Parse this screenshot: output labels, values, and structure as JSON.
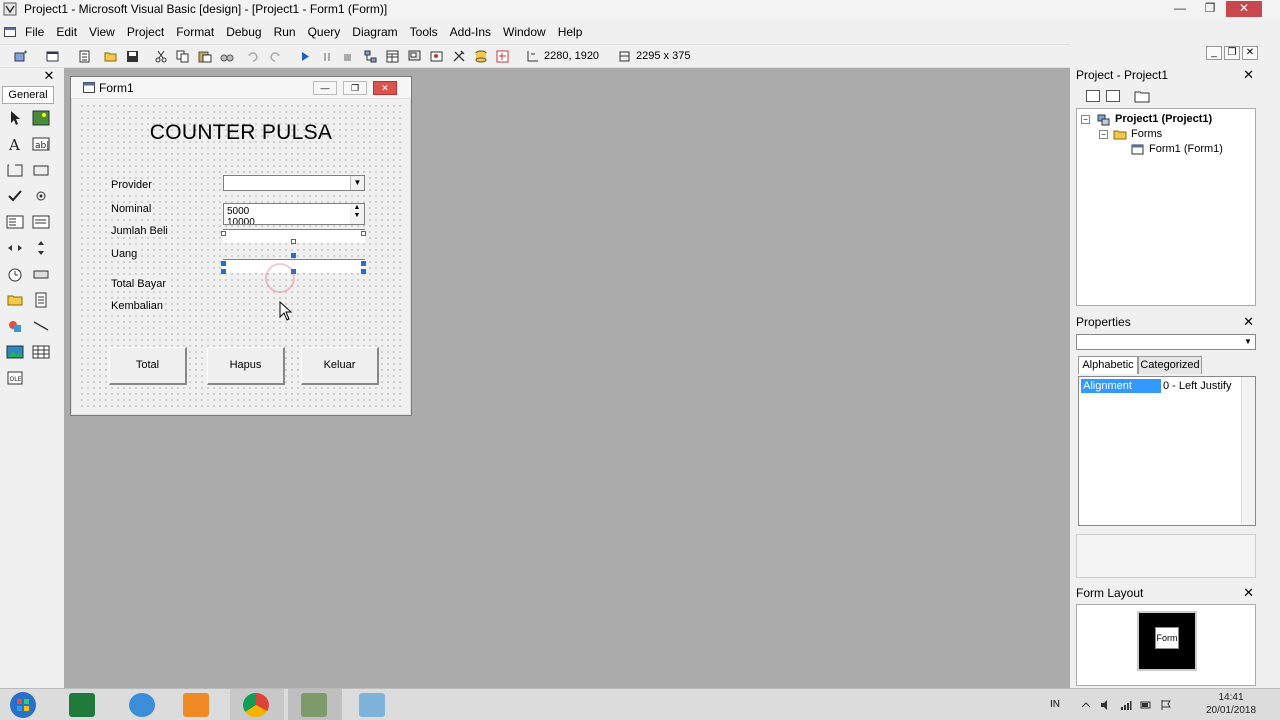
{
  "window": {
    "title": "Project1 - Microsoft Visual Basic [design] - [Project1 - Form1 (Form)]",
    "minimize": "—",
    "maximize": "❐",
    "close": "✕"
  },
  "menu": {
    "items": [
      "File",
      "Edit",
      "View",
      "Project",
      "Format",
      "Debug",
      "Run",
      "Query",
      "Diagram",
      "Tools",
      "Add-Ins",
      "Window",
      "Help"
    ]
  },
  "toolbar": {
    "position": "2280, 1920",
    "size": "2295 x 375"
  },
  "toolbox": {
    "close": "✕",
    "tab": "General"
  },
  "form": {
    "title": "Form1",
    "heading": "COUNTER PULSA",
    "labels": {
      "provider": "Provider",
      "nominal": "Nominal",
      "jumlah_beli": "Jumlah Beli",
      "uang": "Uang",
      "total_bayar": "Total Bayar",
      "kembalian": "Kembalian"
    },
    "nominal_items": [
      "5000",
      "10000"
    ],
    "buttons": {
      "total": "Total",
      "hapus": "Hapus",
      "keluar": "Keluar"
    }
  },
  "project_panel": {
    "title": "Project - Project1",
    "close": "✕",
    "tree": {
      "root": "Project1 (Project1)",
      "folder": "Forms",
      "form": "Form1 (Form1)"
    }
  },
  "properties_panel": {
    "title": "Properties",
    "close": "✕",
    "tabs": [
      "Alphabetic",
      "Categorized"
    ],
    "selected_property": "Alignment",
    "selected_value": "0 - Left Justify"
  },
  "form_layout_panel": {
    "title": "Form Layout",
    "close": "✕",
    "preview_label": "Form"
  },
  "taskbar": {
    "language": "IN",
    "time": "14:41",
    "date": "20/01/2018"
  }
}
